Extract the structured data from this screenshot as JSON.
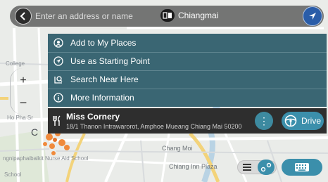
{
  "search": {
    "placeholder": "Enter an address or name",
    "region": "Chiangmai"
  },
  "menu": {
    "items": [
      {
        "label": "Add to My Places",
        "icon": "place-pin-icon"
      },
      {
        "label": "Use as Starting Point",
        "icon": "starting-point-icon"
      },
      {
        "label": "Search Near Here",
        "icon": "search-near-icon"
      },
      {
        "label": "More Information",
        "icon": "info-icon"
      }
    ]
  },
  "place": {
    "title": "Miss Cornery",
    "address": "18/1 Thanon Intrawarorot, Amphoe Mueang Chiang Mai 50200",
    "icon": "restaurant-icon"
  },
  "actions": {
    "more": "⋮",
    "drive": "Drive"
  },
  "zoom": {
    "in": "+",
    "out": "−"
  },
  "map_labels": {
    "college": "College",
    "ho_pha": "Ho Pha Sr",
    "city_part": "C",
    "nurse_school": "ngnipaphaibalkit Nurse Aid School",
    "chang_moi": "Chang Moi",
    "chiang_inn": "Chiang Inn Plaza",
    "school": "School"
  },
  "colors": {
    "menu_bg": "#3a6673",
    "card_bg": "#2e2e2e",
    "accent": "#3b8fab",
    "poi": "#f08a3c"
  }
}
